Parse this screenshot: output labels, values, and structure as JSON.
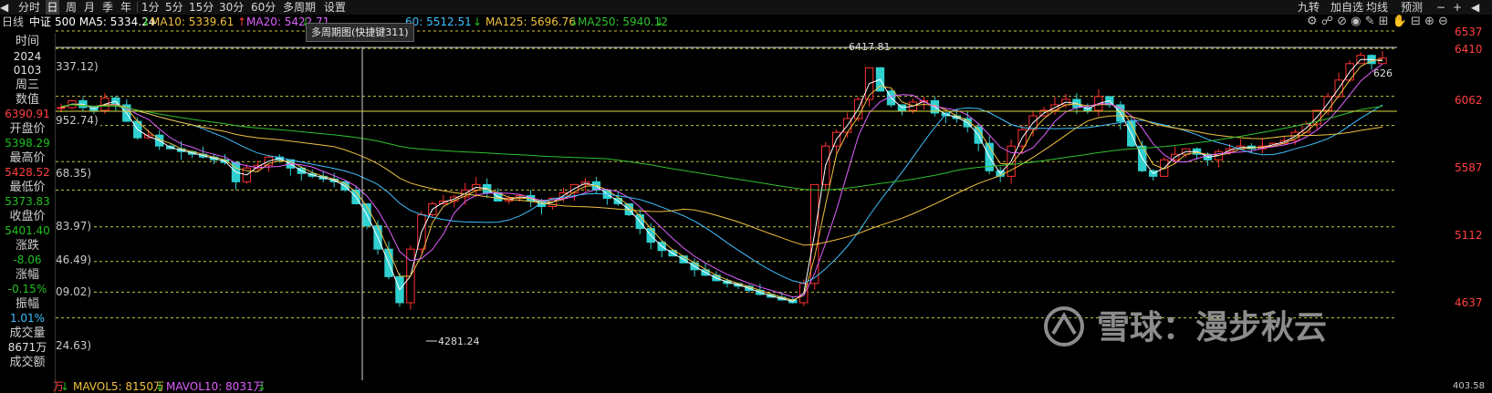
{
  "toolbar": {
    "items": [
      "分时",
      "日",
      "周",
      "月",
      "季",
      "年",
      "1分",
      "5分",
      "15分",
      "30分",
      "60分",
      "多周期",
      "设置"
    ],
    "right_items": [
      "九转",
      "加自选",
      "均线",
      "预测"
    ]
  },
  "info": {
    "prefix": "日线",
    "index": "中证",
    "ma5": "500 MA5: 5334.24",
    "ma10": "MA10: 5339.61",
    "ma20": "MA20: 5422.71",
    "ma60": "60: 5512.51",
    "ma125": "MA125: 5696.76",
    "ma250": "MA250: 5940.12",
    "arrow_down": "↓",
    "arrow_up": "↑"
  },
  "tooltip": "多周期图(快捷键311)",
  "left_panel": {
    "time_label": "时间",
    "year": "2024",
    "date": "0103",
    "weekday": "周三",
    "value_label": "数值",
    "value": "6390.91",
    "open_label": "开盘价",
    "open": "5398.29",
    "high_label": "最高价",
    "high": "5428.52",
    "low_label": "最低价",
    "low": "5373.83",
    "close_label": "收盘价",
    "close": "5401.40",
    "change_label": "涨跌",
    "change": "-8.06",
    "pct_label": "涨幅",
    "pct": "-0.15%",
    "amp_label": "振幅",
    "amp": "1.01%",
    "vol_label": "成交量",
    "vol": "8671万",
    "amt_label": "成交额"
  },
  "left_axis_labels": [
    "337.12)",
    "952.74)",
    "68.35)",
    "83.97)",
    "46.49)",
    "09.02)",
    "24.63)"
  ],
  "right_axis_labels": [
    "6537",
    "6410",
    "6062",
    "5587",
    "5112",
    "4637"
  ],
  "annotations": {
    "high": "6417.81",
    "low": "4281.24",
    "right_value": "626"
  },
  "bottom": {
    "prefix": "万",
    "mavol5": "MAVOL5: 8150万",
    "mavol10": "MAVOL10: 8031万",
    "right": "403.58"
  },
  "watermark": "雪球：漫步秋云",
  "chart_data": {
    "type": "line",
    "y_axis_ticks": [
      6537,
      6410,
      6062,
      5587,
      5112,
      4637
    ],
    "marked_high": 6417.81,
    "marked_low": 4281.24,
    "series": [
      {
        "name": "MA5",
        "color": "#ffffff"
      },
      {
        "name": "MA10",
        "color": "#f0c040"
      },
      {
        "name": "MA20",
        "color": "#e060ff"
      },
      {
        "name": "MA60",
        "color": "#40c0ff"
      },
      {
        "name": "MA125",
        "color": "#f0c040"
      },
      {
        "name": "MA250",
        "color": "#30c030"
      }
    ],
    "close_path": [
      5980,
      6030,
      5980,
      5960,
      6050,
      6000,
      5880,
      5760,
      5780,
      5700,
      5680,
      5660,
      5640,
      5620,
      5600,
      5580,
      5440,
      5540,
      5560,
      5620,
      5600,
      5540,
      5500,
      5480,
      5460,
      5440,
      5380,
      5280,
      5120,
      4950,
      4750,
      4560,
      4950,
      5200,
      5280,
      5300,
      5330,
      5380,
      5420,
      5360,
      5300,
      5320,
      5340,
      5300,
      5260,
      5320,
      5360,
      5420,
      5440,
      5380,
      5320,
      5280,
      5200,
      5100,
      5000,
      4940,
      4900,
      4850,
      4800,
      4760,
      4720,
      4700,
      4680,
      4650,
      4620,
      4600,
      4580,
      4560,
      4700,
      5420,
      5700,
      5800,
      5900,
      6040,
      6270,
      6100,
      6000,
      5960,
      6020,
      6030,
      5940,
      5920,
      5900,
      5840,
      5720,
      5520,
      5480,
      5700,
      5820,
      5920,
      5960,
      6000,
      6040,
      5980,
      5960,
      6060,
      6000,
      5880,
      5700,
      5520,
      5480,
      5600,
      5640,
      5680,
      5640,
      5600,
      5660,
      5680,
      5700,
      5680,
      5700,
      5720,
      5740,
      5800,
      5860,
      5960,
      6060,
      6180,
      6300,
      6360,
      6300,
      6340
    ]
  }
}
